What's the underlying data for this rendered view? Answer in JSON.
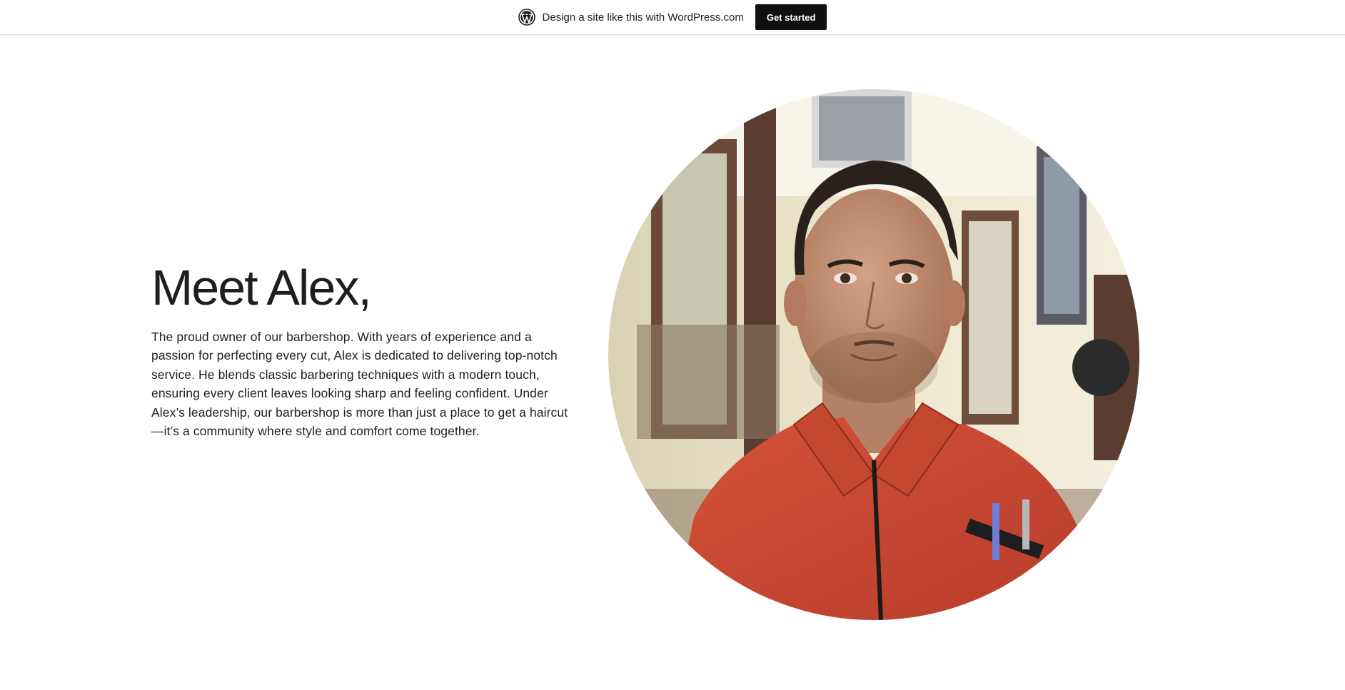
{
  "banner": {
    "logo_icon": "wordpress-logo-icon",
    "text": "Design a site like this with WordPress.com",
    "button_label": "Get started"
  },
  "intro": {
    "title": "Meet Alex,",
    "body": "The proud owner of our barbershop. With years of experience and a passion for perfecting every cut, Alex is dedicated to delivering top-notch service. He blends classic barbering techniques with a modern touch, ensuring every client leaves looking sharp and feeling confident. Under Alex’s leadership, our barbershop is more than just a place to get a haircut—it’s a community where style and comfort come together."
  },
  "photo": {
    "subject": "portrait of barber in red jacket",
    "colors": {
      "jacket": "#c9452f",
      "wall": "#ece3c4",
      "skin": "#c69478"
    }
  }
}
